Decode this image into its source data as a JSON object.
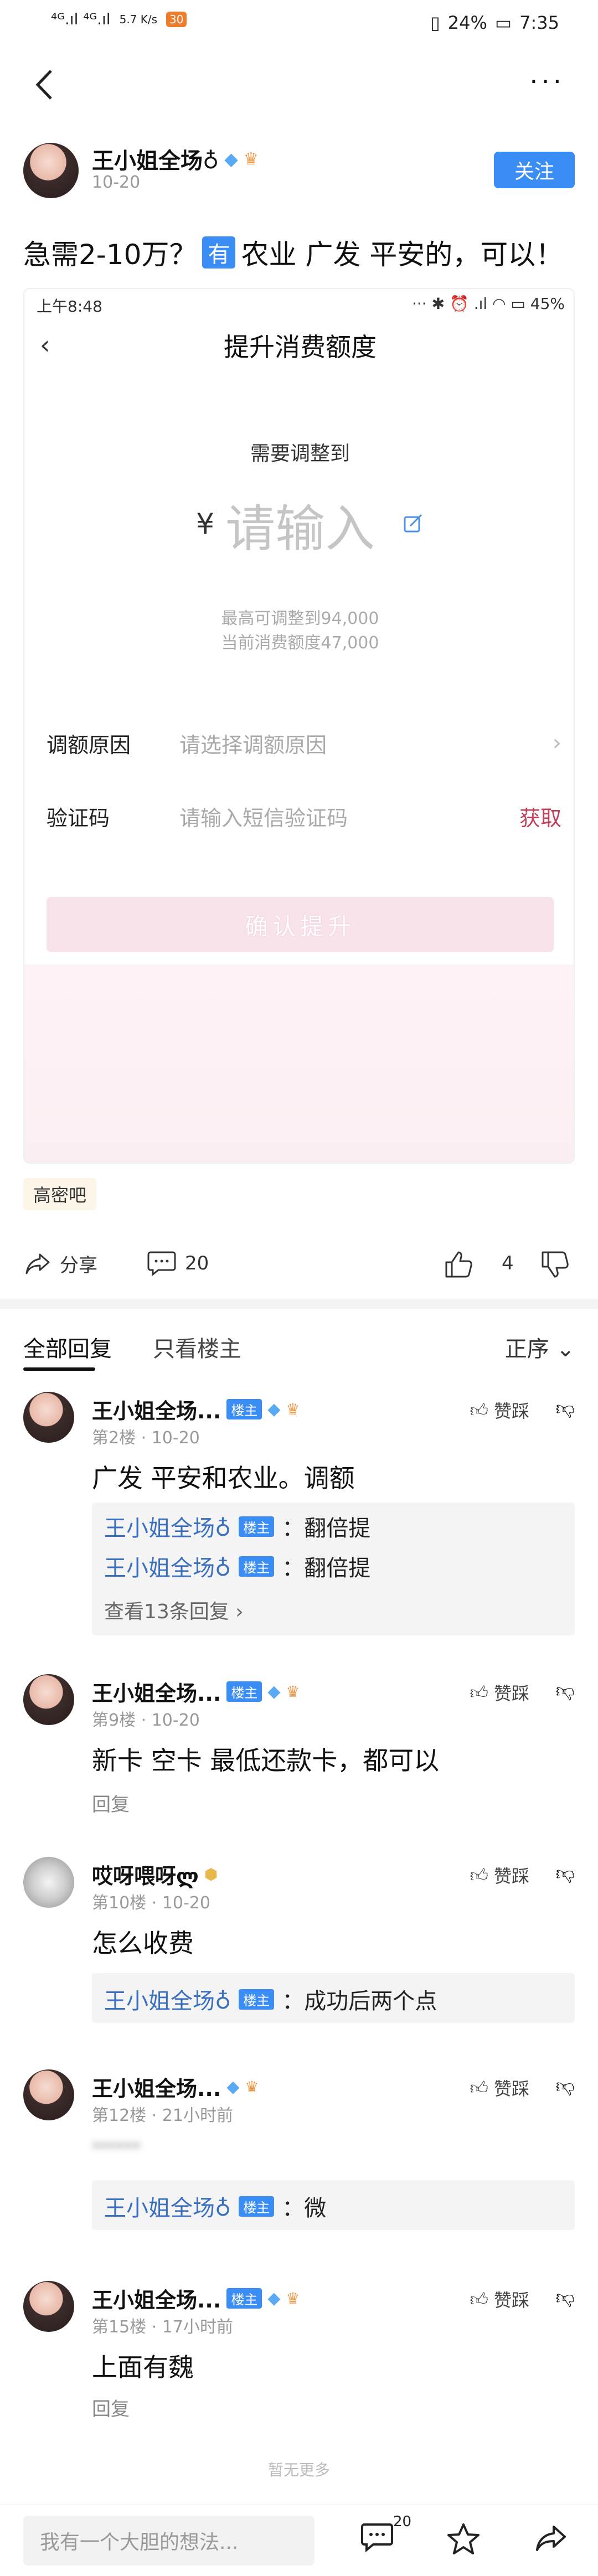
{
  "status_bar": {
    "signal_left": "⁴ᴳ.ıl ⁴ᴳ.ıl",
    "speed": "5.7\nK/s",
    "app_badge": "30",
    "battery": "24%",
    "time": "7:35"
  },
  "post": {
    "author": "王小姐全场♁",
    "date": "10-20",
    "follow_label": "关注",
    "text_before": "急需2-10万？",
    "tag": "有",
    "text_after": "农业 广发 平安的，可以！",
    "forum": "高密吧",
    "share_label": "分享",
    "comment_count": "20",
    "like_count": "4"
  },
  "embedded": {
    "time": "上午8:48",
    "battery": "45%",
    "title": "提升消费额度",
    "need_label": "需要调整到",
    "currency": "¥",
    "amount_placeholder": "请输入",
    "max_text": "最高可调整到94,000",
    "current_text": "当前消费额度47,000",
    "reason_label": "调额原因",
    "reason_placeholder": "请选择调额原因",
    "code_label": "验证码",
    "code_placeholder": "请输入短信验证码",
    "get_label": "获取",
    "confirm_label": "确认提升"
  },
  "tabs": {
    "all": "全部回复",
    "owner_only": "只看楼主",
    "sort": "正序 ⌄"
  },
  "replies": [
    {
      "name": "王小姐全场...",
      "badge": "楼主",
      "meta": "第2楼 · 10-20",
      "like": "赞踩",
      "text": "广发 平安和农业。调额",
      "subs": [
        {
          "user": "王小姐全场♁",
          "badge": "楼主",
          "text": "：翻倍提"
        },
        {
          "user": "王小姐全场♁",
          "badge": "楼主",
          "text": "：翻倍提"
        }
      ],
      "more": "查看13条回复 ›"
    },
    {
      "name": "王小姐全场...",
      "badge": "楼主",
      "meta": "第9楼 · 10-20",
      "like": "赞踩",
      "text": "新卡 空卡 最低还款卡，都可以",
      "reply": "回复"
    },
    {
      "name": "哎呀喂呀ლ",
      "meta": "第10楼 · 10-20",
      "like": "赞踩",
      "text": "怎么收费",
      "subs": [
        {
          "user": "王小姐全场♁",
          "badge": "楼主",
          "text": "：成功后两个点"
        }
      ]
    },
    {
      "name": "王小姐全场...",
      "meta": "第12楼 · 21小时前",
      "like": "赞踩",
      "text": "······",
      "subs": [
        {
          "user": "王小姐全场♁",
          "badge": "楼主",
          "text": "：微"
        }
      ]
    },
    {
      "name": "王小姐全场...",
      "badge": "楼主",
      "meta": "第15楼 · 17小时前",
      "like": "赞踩",
      "text": "上面有魏",
      "reply": "回复"
    }
  ],
  "end_text": "暂无更多",
  "bottom_bar": {
    "input_placeholder": "我有一个大胆的想法...",
    "comment_count": "20"
  },
  "colors": {
    "accent_blue": "#3b8df6",
    "link_blue": "#3b6fbf",
    "pink_action": "#c0405a"
  }
}
